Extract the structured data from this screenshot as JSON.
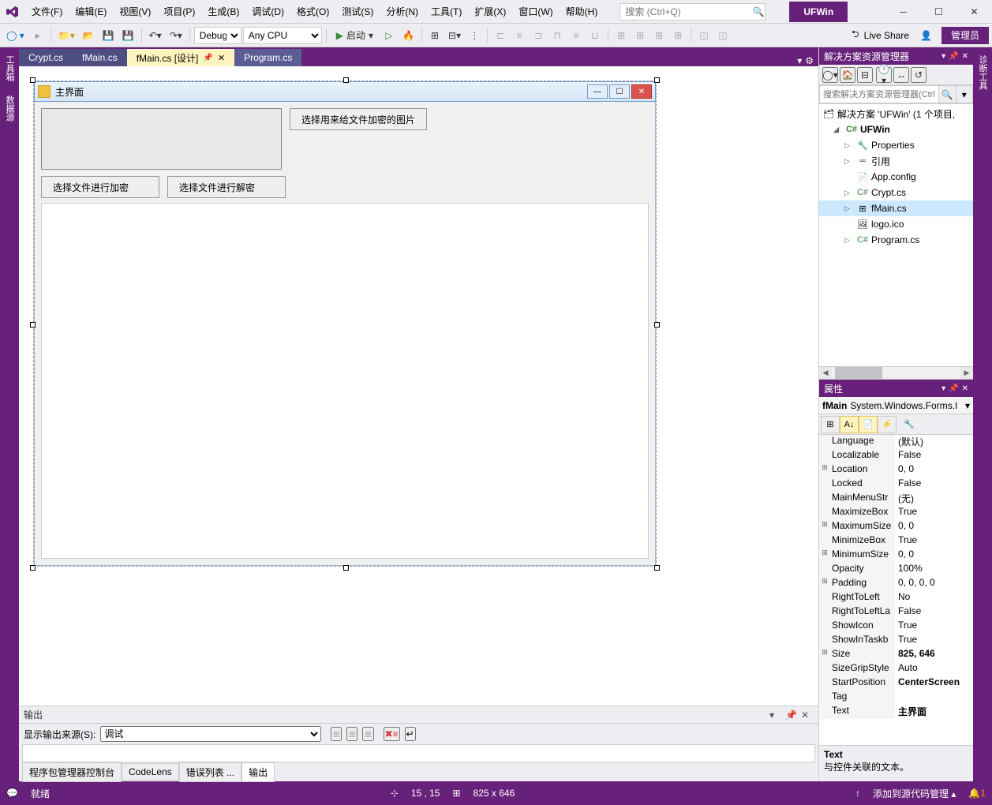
{
  "titlebar": {
    "menus": [
      "文件(F)",
      "编辑(E)",
      "视图(V)",
      "项目(P)",
      "生成(B)",
      "调试(D)",
      "格式(O)",
      "测试(S)",
      "分析(N)",
      "工具(T)",
      "扩展(X)",
      "窗口(W)",
      "帮助(H)"
    ],
    "search_placeholder": "搜索 (Ctrl+Q)",
    "app_title": "UFWin"
  },
  "toolbar": {
    "config": "Debug",
    "platform": "Any CPU",
    "start_label": "启动",
    "live_share": "Live Share",
    "admin": "管理员"
  },
  "left_rail": [
    "工具箱",
    "数据源"
  ],
  "right_rail": [
    "诊断工具"
  ],
  "doc_tabs": [
    {
      "label": "Crypt.cs",
      "active": false
    },
    {
      "label": "fMain.cs",
      "active": false
    },
    {
      "label": "fMain.cs [设计]",
      "active": true,
      "pinned": true
    },
    {
      "label": "Program.cs",
      "active": false
    }
  ],
  "form_designer": {
    "title": "主界面",
    "btn_select_image": "选择用来给文件加密的图片",
    "btn_encrypt": "选择文件进行加密",
    "btn_decrypt": "选择文件进行解密"
  },
  "solution_explorer": {
    "header": "解决方案资源管理器",
    "search_placeholder": "搜索解决方案资源管理器(Ctrl+",
    "solution_label": "解决方案 'UFWin' (1 个项目,",
    "project": "UFWin",
    "items": [
      "Properties",
      "引用",
      "App.config",
      "Crypt.cs",
      "fMain.cs",
      "logo.ico",
      "Program.cs"
    ],
    "cs_label": "C#"
  },
  "properties": {
    "header": "属性",
    "obj_name": "fMain",
    "obj_type": "System.Windows.Forms.I",
    "rows": [
      {
        "exp": "",
        "name": "Language",
        "val": "(默认)"
      },
      {
        "exp": "",
        "name": "Localizable",
        "val": "False"
      },
      {
        "exp": "⊞",
        "name": "Location",
        "val": "0, 0"
      },
      {
        "exp": "",
        "name": "Locked",
        "val": "False"
      },
      {
        "exp": "",
        "name": "MainMenuStr",
        "val": "(无)"
      },
      {
        "exp": "",
        "name": "MaximizeBox",
        "val": "True"
      },
      {
        "exp": "⊞",
        "name": "MaximumSize",
        "val": "0, 0"
      },
      {
        "exp": "",
        "name": "MinimizeBox",
        "val": "True"
      },
      {
        "exp": "⊞",
        "name": "MinimumSize",
        "val": "0, 0"
      },
      {
        "exp": "",
        "name": "Opacity",
        "val": "100%"
      },
      {
        "exp": "⊞",
        "name": "Padding",
        "val": "0, 0, 0, 0"
      },
      {
        "exp": "",
        "name": "RightToLeft",
        "val": "No"
      },
      {
        "exp": "",
        "name": "RightToLeftLa",
        "val": "False"
      },
      {
        "exp": "",
        "name": "ShowIcon",
        "val": "True"
      },
      {
        "exp": "",
        "name": "ShowInTaskb",
        "val": "True"
      },
      {
        "exp": "⊞",
        "name": "Size",
        "val": "825, 646",
        "bold": true
      },
      {
        "exp": "",
        "name": "SizeGripStyle",
        "val": "Auto"
      },
      {
        "exp": "",
        "name": "StartPosition",
        "val": "CenterScreen",
        "bold": true
      },
      {
        "exp": "",
        "name": "Tag",
        "val": ""
      },
      {
        "exp": "",
        "name": "Text",
        "val": "主界面",
        "bold": true
      }
    ],
    "desc_title": "Text",
    "desc_body": "与控件关联的文本。"
  },
  "output": {
    "header": "输出",
    "source_label": "显示输出来源(S):",
    "source_value": "调试",
    "bottom_tabs": [
      "程序包管理器控制台",
      "CodeLens",
      "错误列表 ...",
      "输出"
    ]
  },
  "statusbar": {
    "ready": "就绪",
    "pos": "15 , 15",
    "size": "825 x 646",
    "add_source": "添加到源代码管理",
    "notif": "1"
  }
}
